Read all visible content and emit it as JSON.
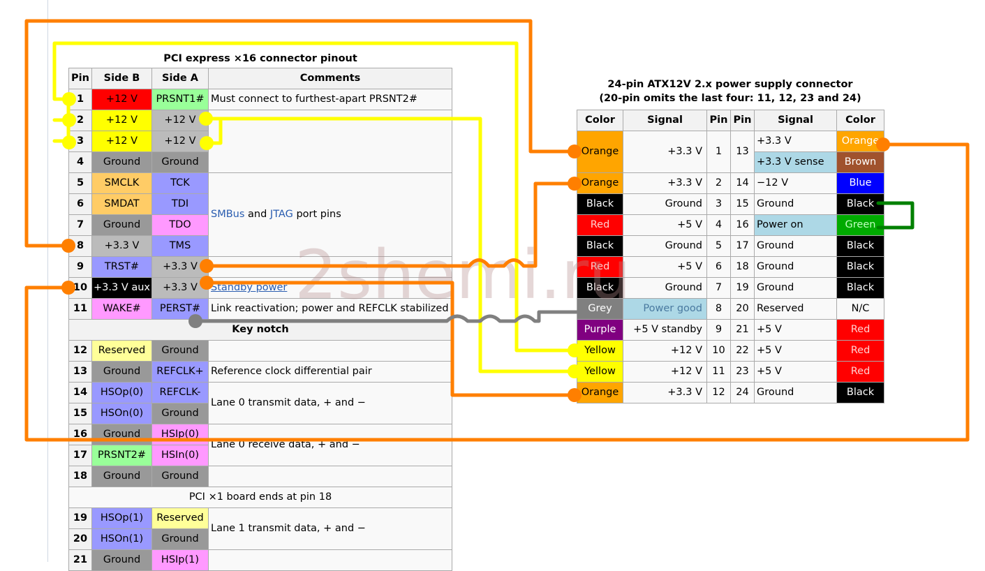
{
  "watermark": "2shemi.ru",
  "pcie": {
    "caption": "PCI express ×16 connector pinout",
    "headers": {
      "pin": "Pin",
      "side_b": "Side B",
      "side_a": "Side A",
      "comments": "Comments"
    },
    "rows": [
      {
        "pin": "1",
        "b": "+12 V",
        "a": "PRSNT1#"
      },
      {
        "pin": "2",
        "b": "+12 V",
        "a": "+12 V"
      },
      {
        "pin": "3",
        "b": "+12 V",
        "a": "+12 V"
      },
      {
        "pin": "4",
        "b": "Ground",
        "a": "Ground"
      },
      {
        "pin": "5",
        "b": "SMCLK",
        "a": "TCK"
      },
      {
        "pin": "6",
        "b": "SMDAT",
        "a": "TDI"
      },
      {
        "pin": "7",
        "b": "Ground",
        "a": "TDO"
      },
      {
        "pin": "8",
        "b": "+3.3 V",
        "a": "TMS"
      },
      {
        "pin": "9",
        "b": "TRST#",
        "a": "+3.3 V"
      },
      {
        "pin": "10",
        "b": "+3.3 V aux",
        "a": "+3.3 V"
      },
      {
        "pin": "11",
        "b": "WAKE#",
        "a": "PERST#"
      },
      {
        "pin": "12",
        "b": "Reserved",
        "a": "Ground"
      },
      {
        "pin": "13",
        "b": "Ground",
        "a": "REFCLK+"
      },
      {
        "pin": "14",
        "b": "HSOp(0)",
        "a": "REFCLK-"
      },
      {
        "pin": "15",
        "b": "HSOn(0)",
        "a": "Ground"
      },
      {
        "pin": "16",
        "b": "Ground",
        "a": "HSIp(0)"
      },
      {
        "pin": "17",
        "b": "PRSNT2#",
        "a": "HSIn(0)"
      },
      {
        "pin": "18",
        "b": "Ground",
        "a": "Ground"
      },
      {
        "pin": "19",
        "b": "HSOp(1)",
        "a": "Reserved"
      },
      {
        "pin": "20",
        "b": "HSOn(1)",
        "a": "Ground"
      },
      {
        "pin": "21",
        "b": "Ground",
        "a": "HSIp(1)"
      }
    ],
    "comments": {
      "c1": "Must connect to furthest-apart PRSNT2#",
      "smbus": "SMBus",
      "and": " and ",
      "jtag": "JTAG",
      "port_pins": " port pins",
      "standby": "Standby power",
      "link": "Link reactivation; power and REFCLK stabilized",
      "key_notch": "Key notch",
      "refclk": "Reference clock differential pair",
      "lane0_tx": "Lane 0 transmit data, + and −",
      "lane0_rx": "Lane 0 receive data, + and −",
      "x1_end": "PCI ×1 board ends at pin 18",
      "lane1_tx": "Lane 1 transmit data, + and −"
    },
    "colors": {
      "red": "#ff0000",
      "yellow": "#ffff00",
      "grey": "#999999",
      "lightorange": "#ffcc66",
      "lavender": "#9999ff",
      "pink": "#ff99ff",
      "lightgreen": "#99ff99",
      "lightyellow": "#ffff99",
      "black": "#000000"
    }
  },
  "atx": {
    "caption_line1": "24-pin ATX12V 2.x power supply connector",
    "caption_line2": "(20-pin omits the last four: 11, 12, 23 and 24)",
    "headers": {
      "color": "Color",
      "signal": "Signal",
      "pin": "Pin"
    },
    "rows": [
      {
        "lcolor": "Orange",
        "lsignal": "+3.3 V",
        "lpin": "1",
        "rpin": "13",
        "rsignal": "+3.3 V",
        "rcolor": "Orange",
        "rsignal2": "+3.3 V sense",
        "rcolor2": "Brown"
      },
      {
        "lcolor": "Orange",
        "lsignal": "+3.3 V",
        "lpin": "2",
        "rpin": "14",
        "rsignal": "−12 V",
        "rcolor": "Blue"
      },
      {
        "lcolor": "Black",
        "lsignal": "Ground",
        "lpin": "3",
        "rpin": "15",
        "rsignal": "Ground",
        "rcolor": "Black"
      },
      {
        "lcolor": "Red",
        "lsignal": "+5 V",
        "lpin": "4",
        "rpin": "16",
        "rsignal": "Power on",
        "rcolor": "Green"
      },
      {
        "lcolor": "Black",
        "lsignal": "Ground",
        "lpin": "5",
        "rpin": "17",
        "rsignal": "Ground",
        "rcolor": "Black"
      },
      {
        "lcolor": "Red",
        "lsignal": "+5 V",
        "lpin": "6",
        "rpin": "18",
        "rsignal": "Ground",
        "rcolor": "Black"
      },
      {
        "lcolor": "Black",
        "lsignal": "Ground",
        "lpin": "7",
        "rpin": "19",
        "rsignal": "Ground",
        "rcolor": "Black"
      },
      {
        "lcolor": "Grey",
        "lsignal": "Power good",
        "lpin": "8",
        "rpin": "20",
        "rsignal": "Reserved",
        "rcolor": "N/C"
      },
      {
        "lcolor": "Purple",
        "lsignal": "+5 V standby",
        "lpin": "9",
        "rpin": "21",
        "rsignal": "+5 V",
        "rcolor": "Red"
      },
      {
        "lcolor": "Yellow",
        "lsignal": "+12 V",
        "lpin": "10",
        "rpin": "22",
        "rsignal": "+5 V",
        "rcolor": "Red"
      },
      {
        "lcolor": "Yellow",
        "lsignal": "+12 V",
        "lpin": "11",
        "rpin": "23",
        "rsignal": "+5 V",
        "rcolor": "Red"
      },
      {
        "lcolor": "Orange",
        "lsignal": "+3.3 V",
        "lpin": "12",
        "rpin": "24",
        "rsignal": "Ground",
        "rcolor": "Black"
      }
    ],
    "colors": {
      "orange": "#ffa500",
      "brown": "#a0522d",
      "blue": "#0000ff",
      "black": "#000000",
      "red": "#ff0000",
      "green": "#00aa00",
      "grey": "#808080",
      "purple": "#800080",
      "yellow": "#ffff00",
      "lightblue": "#add8e6"
    }
  },
  "wire_colors": {
    "orange": "#ff7f00",
    "yellow": "#ffff00",
    "grey": "#808080",
    "green": "#008000"
  }
}
